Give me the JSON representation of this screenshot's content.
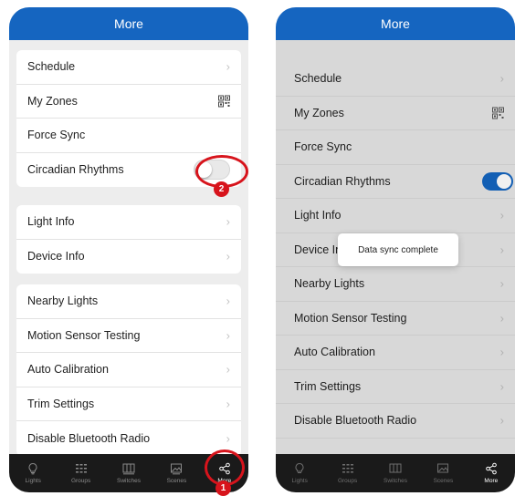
{
  "left": {
    "title": "More",
    "groups": [
      {
        "items": [
          {
            "label": "Schedule",
            "right": "chevron"
          },
          {
            "label": "My Zones",
            "right": "qr"
          },
          {
            "label": "Force Sync",
            "right": "none"
          },
          {
            "label": "Circadian Rhythms",
            "right": "toggle-off"
          }
        ]
      },
      {
        "items": [
          {
            "label": "Light Info",
            "right": "chevron"
          },
          {
            "label": "Device Info",
            "right": "chevron"
          }
        ]
      },
      {
        "items": [
          {
            "label": "Nearby Lights",
            "right": "chevron"
          },
          {
            "label": "Motion Sensor Testing",
            "right": "chevron"
          },
          {
            "label": "Auto Calibration",
            "right": "chevron"
          },
          {
            "label": "Trim Settings",
            "right": "chevron"
          },
          {
            "label": "Disable Bluetooth Radio",
            "right": "chevron"
          }
        ]
      }
    ],
    "tabs": [
      {
        "label": "Lights",
        "icon": "bulb-icon",
        "active": false
      },
      {
        "label": "Groups",
        "icon": "grid-icon",
        "active": false
      },
      {
        "label": "Switches",
        "icon": "switches-icon",
        "active": false
      },
      {
        "label": "Scenes",
        "icon": "image-icon",
        "active": false
      },
      {
        "label": "More",
        "icon": "share-icon",
        "active": true
      }
    ],
    "annotations": {
      "badge_more": "1",
      "badge_toggle": "2"
    }
  },
  "right": {
    "title": "More",
    "items": [
      {
        "label": "Schedule"
      },
      {
        "label": "My Zones"
      },
      {
        "label": "Force Sync"
      },
      {
        "label": "Circadian Rhythms",
        "toggle": "on"
      },
      {
        "label": "Light Info"
      },
      {
        "label": "Device Info"
      },
      {
        "label": "Nearby Lights"
      },
      {
        "label": "Motion Sensor Testing"
      },
      {
        "label": "Auto Calibration"
      },
      {
        "label": "Trim Settings"
      },
      {
        "label": "Disable Bluetooth Radio"
      }
    ],
    "toast": "Data sync complete",
    "tabs": [
      {
        "label": "Lights"
      },
      {
        "label": "Groups"
      },
      {
        "label": "Switches"
      },
      {
        "label": "Scenes"
      },
      {
        "label": "More"
      }
    ]
  },
  "colors": {
    "header": "#1565c0",
    "tabbar": "#1a1a1a",
    "annotation": "#d7141c",
    "background": "#ededed"
  }
}
